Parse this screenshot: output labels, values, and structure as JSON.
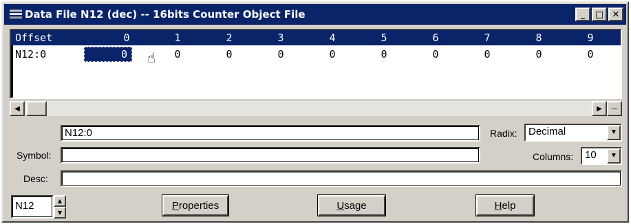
{
  "window": {
    "title": "Data File N12 (dec) -- 16bits Counter Object File",
    "buttons": {
      "minimize": "_",
      "maximize": "□",
      "close": "✕"
    }
  },
  "grid": {
    "offset_header": "Offset",
    "columns": [
      "0",
      "1",
      "2",
      "3",
      "4",
      "5",
      "6",
      "7",
      "8",
      "9"
    ],
    "rows": [
      {
        "label": "N12:0",
        "values": [
          "0",
          "0",
          "0",
          "0",
          "0",
          "0",
          "0",
          "0",
          "0",
          "0"
        ]
      }
    ],
    "selected_cell": "0"
  },
  "scrollbar": {
    "left_arrow": "◀",
    "right_arrow": "▶",
    "minus": "—"
  },
  "address_field": {
    "value": "N12:0"
  },
  "radix": {
    "label": "Radix:",
    "value": "Decimal"
  },
  "symbol": {
    "label": "Symbol:",
    "value": ""
  },
  "columns_ctrl": {
    "label": "Columns:",
    "value": "10"
  },
  "desc": {
    "label": "Desc:",
    "value": ""
  },
  "file_selector": {
    "value": "N12",
    "up": "▲",
    "down": "▼"
  },
  "actions": {
    "properties": {
      "accel": "P",
      "rest": "roperties"
    },
    "usage": {
      "accel": "U",
      "rest": "sage"
    },
    "help": {
      "accel": "H",
      "rest": "elp"
    }
  }
}
